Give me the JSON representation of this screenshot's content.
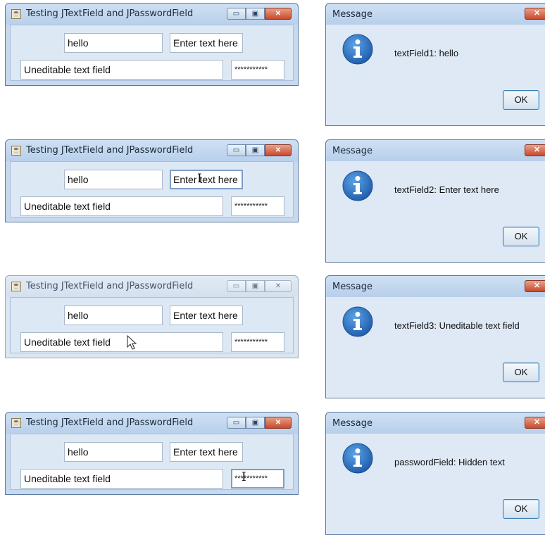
{
  "frames": [
    {
      "title": "Testing JTextField and JPasswordField",
      "active": true,
      "text_field_1": "hello",
      "text_field_2": "Enter text here",
      "text_field_3": "Uneditable text field",
      "password_field": "***********",
      "controls": {
        "minimize": "▭",
        "maximize": "▣",
        "close": "✕"
      }
    },
    {
      "title": "Testing JTextField and JPasswordField",
      "active": true,
      "text_field_1": "hello",
      "text_field_2": "Enter text here",
      "text_field_3": "Uneditable text field",
      "password_field": "***********",
      "controls": {
        "minimize": "▭",
        "maximize": "▣",
        "close": "✕"
      }
    },
    {
      "title": "Testing JTextField and JPasswordField",
      "active": false,
      "text_field_1": "hello",
      "text_field_2": "Enter text here",
      "text_field_3": "Uneditable text field",
      "password_field": "***********",
      "controls": {
        "minimize": "▭",
        "maximize": "▣",
        "close": "✕"
      }
    },
    {
      "title": "Testing JTextField and JPasswordField",
      "active": true,
      "text_field_1": "hello",
      "text_field_2": "Enter text here",
      "text_field_3": "Uneditable text field",
      "password_field": "***********",
      "controls": {
        "minimize": "▭",
        "maximize": "▣",
        "close": "✕"
      }
    }
  ],
  "dialogs": [
    {
      "title": "Message",
      "message": "textField1: hello",
      "ok_label": "OK",
      "close_label": "✕",
      "icon": "info-icon"
    },
    {
      "title": "Message",
      "message": "textField2: Enter text here",
      "ok_label": "OK",
      "close_label": "✕",
      "icon": "info-icon"
    },
    {
      "title": "Message",
      "message": "textField3: Uneditable text field",
      "ok_label": "OK",
      "close_label": "✕",
      "icon": "info-icon"
    },
    {
      "title": "Message",
      "message": "passwordField: Hidden text",
      "ok_label": "OK",
      "close_label": "✕",
      "icon": "info-icon"
    }
  ],
  "colors": {
    "title_gradient_top": "#cfe0f3",
    "content_bg": "#dde8f5",
    "close_button": "#c9492c",
    "info_icon": "#2b6cb8"
  }
}
